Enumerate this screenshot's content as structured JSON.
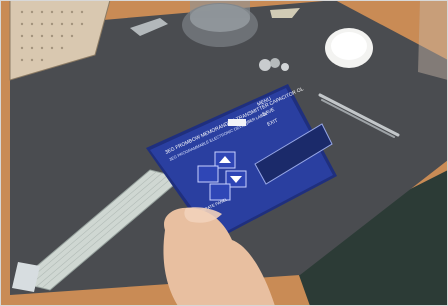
{
  "photo": {
    "colors": {
      "table": "#c98b55",
      "mat": "#4a4c50",
      "panel": "#2a3fa0",
      "panel_edge": "#1f2f7e",
      "display_window": "#1b2a6a",
      "ribbon": "#cfd7d2",
      "skin": "#e8bfa0",
      "carpet": "#2c3b36"
    },
    "overlay_texts": {
      "panel_header_line1": "3EG FROMBOW MEMORANDUM TRANSMITTER CAPACITOR OL",
      "panel_header_line2": "3EG PROGRAMMABLE ELECTRONIC DEVICE",
      "panel_small_line": "IBER LABEL",
      "panel_right_block": "MENU",
      "panel_right_block2": "SAVE",
      "panel_right_block3": "EXIT",
      "panel_bottom_line": "OPERATE PANEL"
    },
    "objects": [
      "perfboard-icon",
      "glass-jar-icon",
      "white-cap-icon",
      "tweezers-icon",
      "membrane-keypad-icon",
      "flat-ribbon-cable-icon",
      "hand-icon"
    ]
  }
}
